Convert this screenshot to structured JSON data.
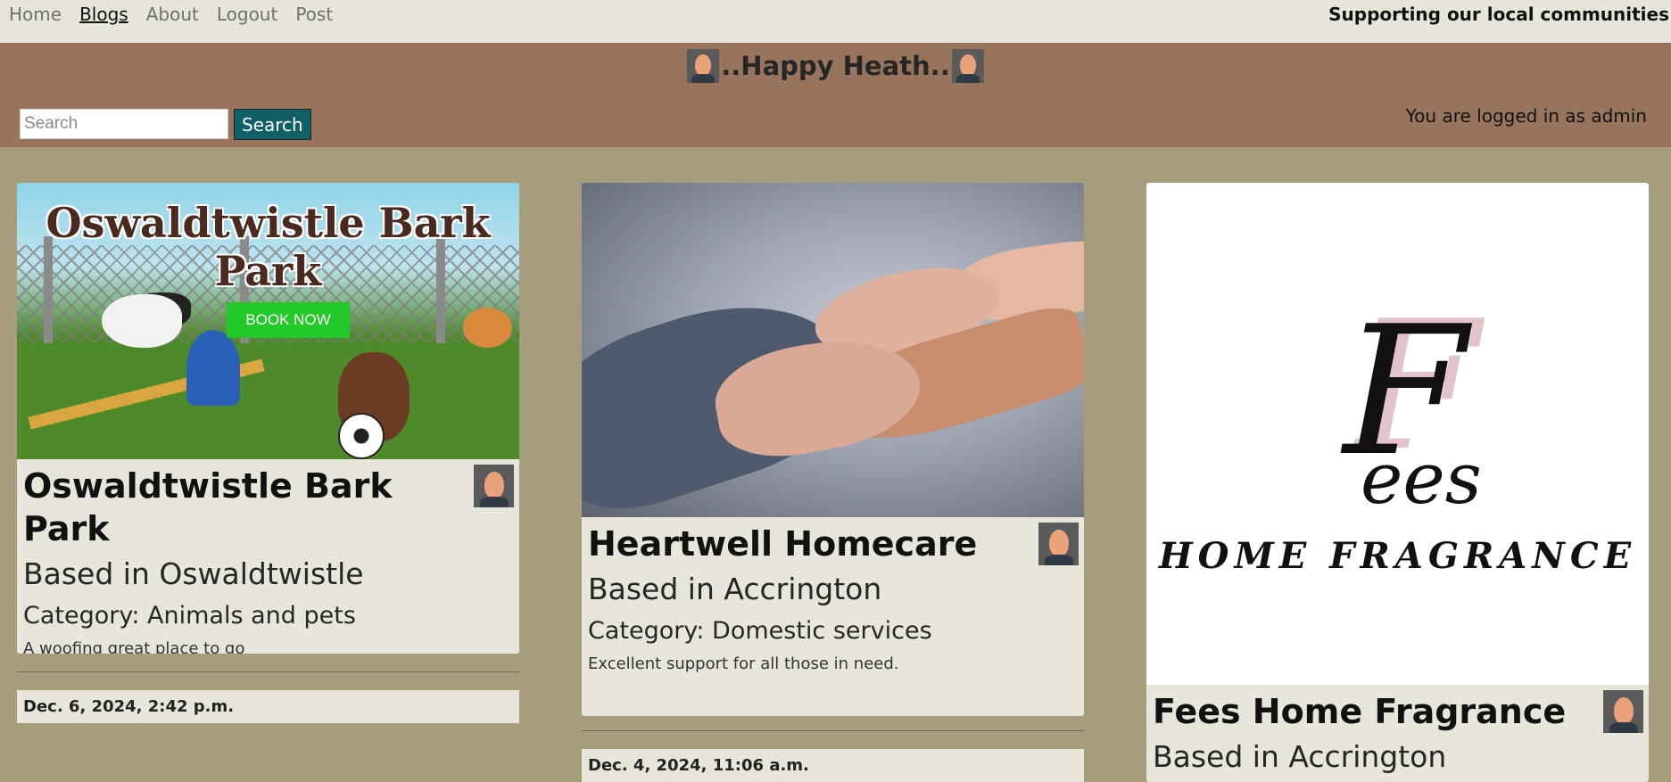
{
  "nav": {
    "links": [
      "Home",
      "Blogs",
      "About",
      "Logout",
      "Post"
    ],
    "active": "Blogs",
    "tagline": "Supporting our local communities"
  },
  "header": {
    "title": "..Happy Heath..",
    "search_placeholder": "Search",
    "search_button": "Search",
    "login_status": "You are logged in as admin"
  },
  "posts": [
    {
      "title": "Oswaldtwistle Bark Park",
      "location": "Based in Oswaldtwistle",
      "category": "Category: Animals and pets",
      "description": "A woofing great place to go",
      "date": "Dec. 6, 2024, 2:42 p.m.",
      "image": {
        "heading": "Oswaldtwistle Bark Park",
        "button": "BOOK NOW"
      }
    },
    {
      "title": "Heartwell Homecare",
      "location": "Based in Accrington",
      "category": "Category: Domestic services",
      "description": "Excellent support for all those in need.",
      "date": "Dec. 4, 2024, 11:06 a.m."
    },
    {
      "title": "Fees Home Fragrance",
      "location": "Based in Accrington",
      "image": {
        "letter": "F",
        "word": "ees",
        "subtitle": "HOME FRAGRANCE"
      }
    }
  ],
  "colors": {
    "nav_bg": "#e8e5da",
    "header_bg": "#98745c",
    "page_bg": "#a59d7c",
    "search_button_bg": "#0f5f66",
    "card_bg": "#e8e5da"
  },
  "icons": [
    "avatar-icon"
  ]
}
